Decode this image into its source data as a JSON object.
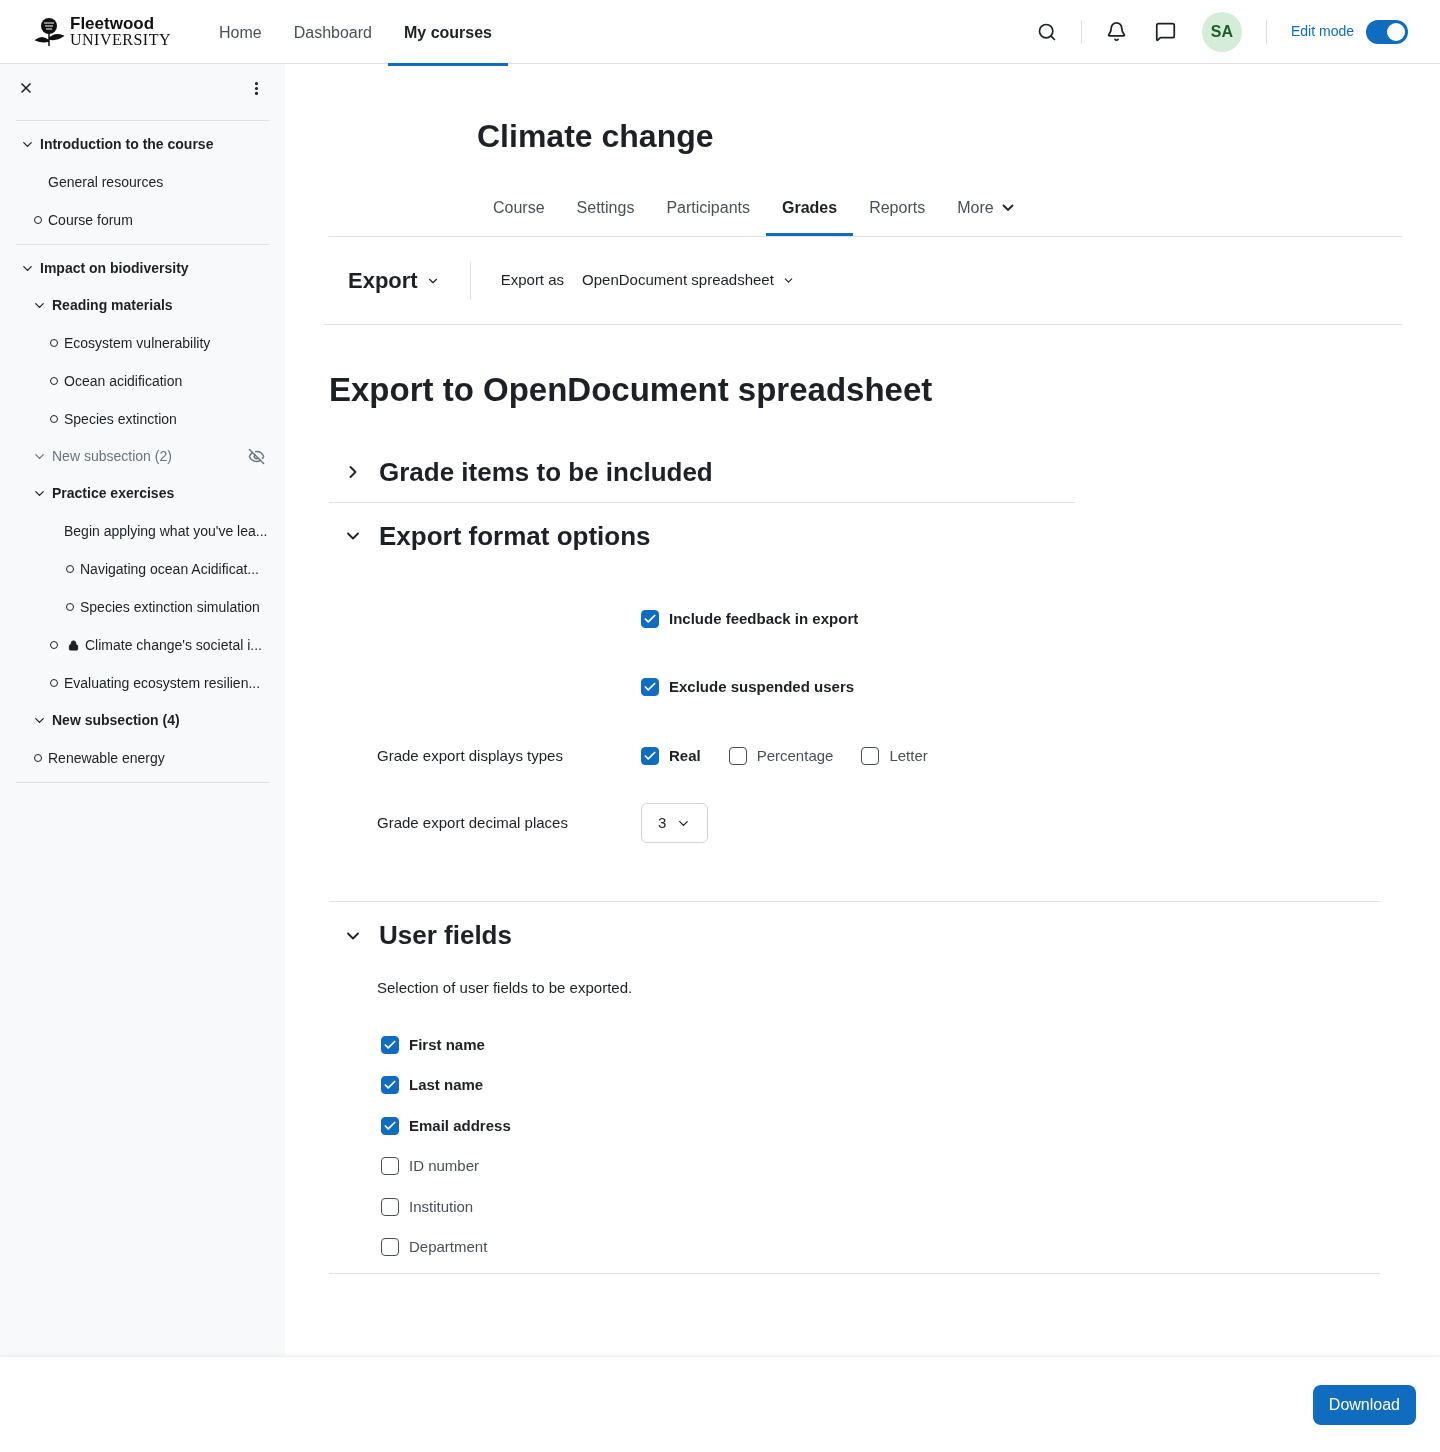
{
  "brand": {
    "name": "Fleetwood",
    "subtitle": "UNIVERSITY"
  },
  "nav": [
    {
      "label": "Home",
      "selected": false
    },
    {
      "label": "Dashboard",
      "selected": false
    },
    {
      "label": "My courses",
      "selected": true
    }
  ],
  "user": {
    "initials": "SA"
  },
  "edit_mode": {
    "label": "Edit mode",
    "on": true
  },
  "course_index": [
    {
      "kind": "section",
      "label": "Introduction to the course",
      "expanded": true,
      "children": [
        {
          "kind": "label",
          "label": "General resources"
        },
        {
          "kind": "activity",
          "label": "Course forum",
          "locked": false
        }
      ]
    },
    {
      "kind": "section",
      "label": "Impact on biodiversity",
      "expanded": true,
      "children": [
        {
          "kind": "subsection",
          "label": "Reading materials",
          "expanded": true,
          "hidden": false,
          "children": [
            {
              "kind": "activity",
              "label": "Ecosystem vulnerability",
              "locked": false
            },
            {
              "kind": "activity",
              "label": "Ocean acidification",
              "locked": false
            },
            {
              "kind": "activity",
              "label": "Species extinction",
              "locked": false
            }
          ]
        },
        {
          "kind": "subsection",
          "label": "New subsection (2)",
          "expanded": true,
          "hidden": true
        },
        {
          "kind": "subsection",
          "label": "Practice exercises",
          "expanded": true,
          "hidden": false,
          "children": [
            {
              "kind": "label",
              "label": "Begin applying what you've lea...",
              "children": [
                {
                  "kind": "activity",
                  "label": "Navigating ocean Acidificat...",
                  "locked": false
                },
                {
                  "kind": "activity",
                  "label": "Species extinction simulation",
                  "locked": false
                }
              ]
            },
            {
              "kind": "activity",
              "label": "Climate change's societal i...",
              "locked": true
            },
            {
              "kind": "activity",
              "label": "Evaluating ecosystem resilien...",
              "locked": false
            }
          ]
        },
        {
          "kind": "subsection",
          "label": "New subsection (4)",
          "expanded": true,
          "hidden": false
        },
        {
          "kind": "activity",
          "label": "Renewable energy",
          "locked": false
        }
      ]
    }
  ],
  "course": {
    "title": "Climate change",
    "tabs": [
      {
        "label": "Course",
        "selected": false
      },
      {
        "label": "Settings",
        "selected": false
      },
      {
        "label": "Participants",
        "selected": false
      },
      {
        "label": "Grades",
        "selected": true
      },
      {
        "label": "Reports",
        "selected": false
      },
      {
        "label": "More",
        "selected": false
      }
    ]
  },
  "tertiary": {
    "title": "Export",
    "export_as_label": "Export as",
    "export_as_value": "OpenDocument spreadsheet"
  },
  "page_title": "Export to OpenDocument spreadsheet",
  "grade_items_section": {
    "title": "Grade items to be included",
    "expanded": false
  },
  "format_section": {
    "title": "Export format options",
    "expanded": true,
    "toggles": [
      {
        "label": "Include feedback in export",
        "checked": true
      },
      {
        "label": "Exclude suspended users",
        "checked": true
      }
    ],
    "display_types": {
      "label": "Grade export displays types",
      "options": [
        {
          "label": "Real",
          "checked": true
        },
        {
          "label": "Percentage",
          "checked": false
        },
        {
          "label": "Letter",
          "checked": false
        }
      ]
    },
    "decimal_places": {
      "label": "Grade export decimal places",
      "value": "3"
    }
  },
  "user_fields_section": {
    "title": "User fields",
    "expanded": true,
    "description": "Selection of user fields to be exported.",
    "fields": [
      {
        "label": "First name",
        "checked": true
      },
      {
        "label": "Last name",
        "checked": true
      },
      {
        "label": "Email address",
        "checked": true
      },
      {
        "label": "ID number",
        "checked": false
      },
      {
        "label": "Institution",
        "checked": false
      },
      {
        "label": "Department",
        "checked": false
      }
    ]
  },
  "footer": {
    "button": "Download"
  }
}
